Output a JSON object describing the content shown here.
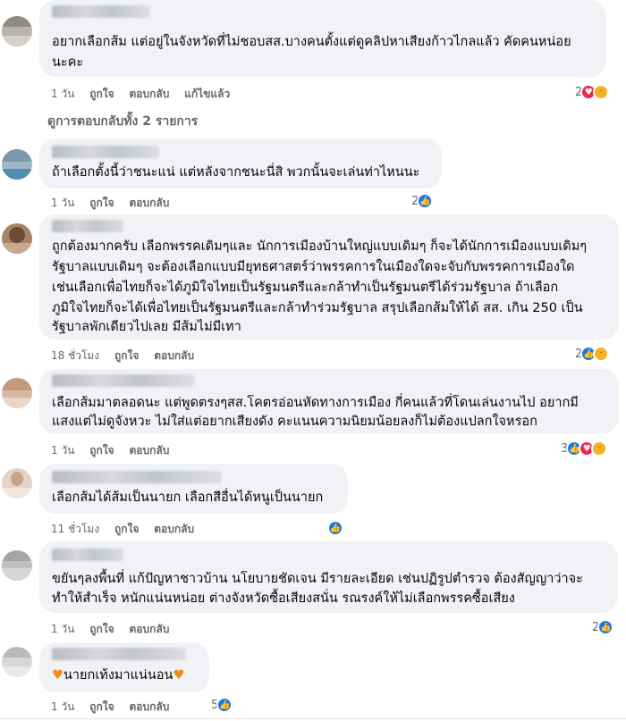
{
  "actions": {
    "like": "ถูกใจ",
    "reply": "ตอบกลับ",
    "edited": "แก้ไขแล้ว"
  },
  "view_replies": "ดูการตอบกลับทั้ง 2 รายการ",
  "comments": [
    {
      "lines": [
        "อยากเลือกส้ม แต่อยู่ในจังหวัดที่ไม่ชอบสส.บางคนตั้งแต่ดูคลิปหาเสียงก้าวไกลแล้ว คัดคนหน่อย",
        "นะคะ"
      ],
      "time": "1 วัน",
      "reaction_count": "2",
      "reaction_icons": [
        "love-icon",
        "haha-icon"
      ]
    },
    {
      "lines": [
        "ถ้าเลือกตั้งนี้ว่าชนะแน่ แต่หลังจากชนะนี่สิ พวกนั้นจะเล่นท่าไหนนะ"
      ],
      "time": "1 วัน",
      "reaction_count": "2",
      "reaction_icons": [
        "like-icon"
      ]
    },
    {
      "lines": [
        "ถูกต้องมากครับ เลือกพรรคเดิมๆและ นักการเมืองบ้านใหญ่แบบเดิมๆ ก็จะได้นักการเมืองแบบเดิมๆ",
        "รัฐบาลแบบเดิมๆ จะต้องเลือกแบบมียุทธศาสตร์ว่าพรรคการในเมืองใดจะจับกับพรรคการเมืองใด",
        "เช่นเลือกเพื่อไทยก็จะได้ภูมิใจไทยเป็นรัฐมนตรีและกล้าทำเป็นรัฐมนตรีได้ร่วมรัฐบาล ถ้าเลือก",
        "ภูมิใจไทยก็จะได้เพื่อไทยเป็นรัฐมนตรีและกล้าทำร่วมรัฐบาล สรุปเลือกส้มให้ได้ สส. เกิน 250 เป็น",
        "รัฐบาลพักเดียวไปเลย มีส้มไม่มีเทา"
      ],
      "time": "18 ชั่วโมง",
      "reaction_count": "2",
      "reaction_icons": [
        "like-icon",
        "haha-icon"
      ]
    },
    {
      "lines": [
        "เลือกส้มมาตลอดนะ แต่พูดตรงๆสส.โคตรอ่อนหัดทางการเมือง กี่คนแล้วที่โดนเล่นงานไป อยากมี",
        "แสงแต่ไม่ดูจังหวะ ไม่ใส่แต่อยากเสียงดัง คะแนนความนิยมน้อยลงก็ไม่ต้องแปลกใจหรอก"
      ],
      "time": "1 วัน",
      "reaction_count": "3",
      "reaction_icons": [
        "like-icon",
        "love-icon",
        "haha-icon"
      ]
    },
    {
      "lines": [
        "เลือกส้มได้ส้มเป็นนายก เลือกสีอื่นได้หนูเป็นนายก"
      ],
      "time": "11 ชั่วโมง",
      "reaction_count": "",
      "reaction_icons": [
        "like-icon"
      ]
    },
    {
      "lines": [
        "ขยันๆลงพื้นที่ แก้ปัญหาชาวบ้าน นโยบายชัดเจน มีรายละเอียด เช่นปฏิรูปตำรวจ ต้องสัญญาว่าจะ",
        "ทำให้สำเร็จ หนักแน่นหน่อย ต่างจังหวัดซื้อเสียงสนั่น รณรงค์ให้ไม่เลือกพรรคซื้อเสียง"
      ],
      "time": "1 วัน",
      "reaction_count": "2",
      "reaction_icons": [
        "like-icon"
      ]
    },
    {
      "lines": [
        "นายกเท้งมาแน่นอน"
      ],
      "heart_glyph": "♥",
      "time": "1 วัน",
      "reaction_count": "5",
      "reaction_icons": [
        "like-icon"
      ]
    }
  ]
}
